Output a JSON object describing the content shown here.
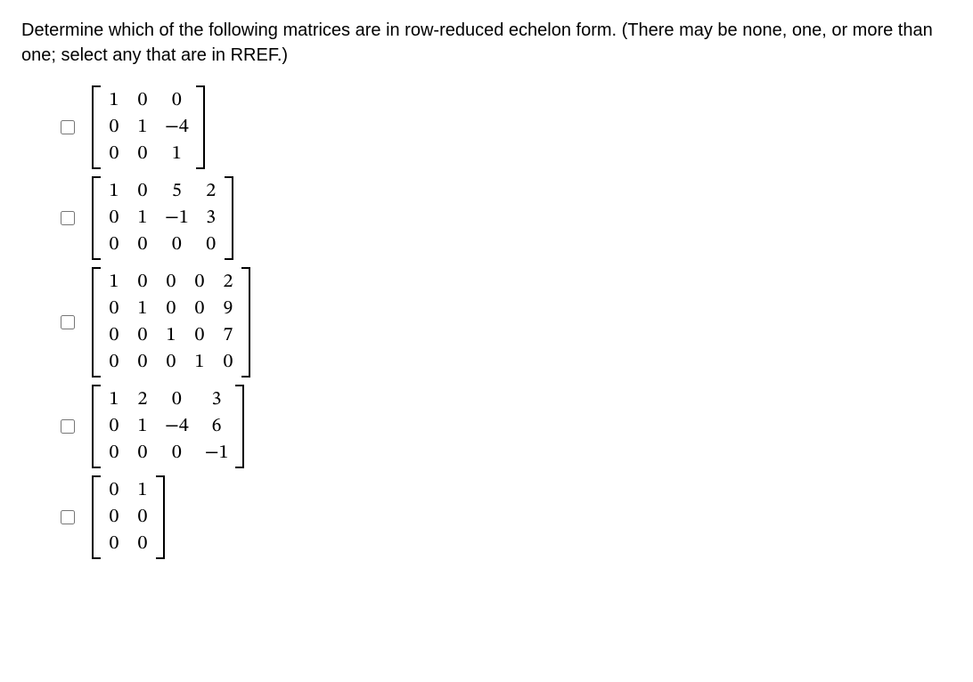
{
  "question": "Determine which of the following matrices are in row-reduced echelon form. (There may be none, one, or more than one; select any that are in RREF.)",
  "options": [
    {
      "rows": 3,
      "cols": 3,
      "cells": [
        "1",
        "0",
        "0",
        "0",
        "1",
        "−4",
        "0",
        "0",
        "1"
      ]
    },
    {
      "rows": 3,
      "cols": 4,
      "cells": [
        "1",
        "0",
        "5",
        "2",
        "0",
        "1",
        "−1",
        "3",
        "0",
        "0",
        "0",
        "0"
      ]
    },
    {
      "rows": 4,
      "cols": 5,
      "cells": [
        "1",
        "0",
        "0",
        "0",
        "2",
        "0",
        "1",
        "0",
        "0",
        "9",
        "0",
        "0",
        "1",
        "0",
        "7",
        "0",
        "0",
        "0",
        "1",
        "0"
      ]
    },
    {
      "rows": 3,
      "cols": 4,
      "cells": [
        "1",
        "2",
        "0",
        "3",
        "0",
        "1",
        "−4",
        "6",
        "0",
        "0",
        "0",
        "−1"
      ]
    },
    {
      "rows": 3,
      "cols": 2,
      "cells": [
        "0",
        "1",
        "0",
        "0",
        "0",
        "0"
      ]
    }
  ]
}
